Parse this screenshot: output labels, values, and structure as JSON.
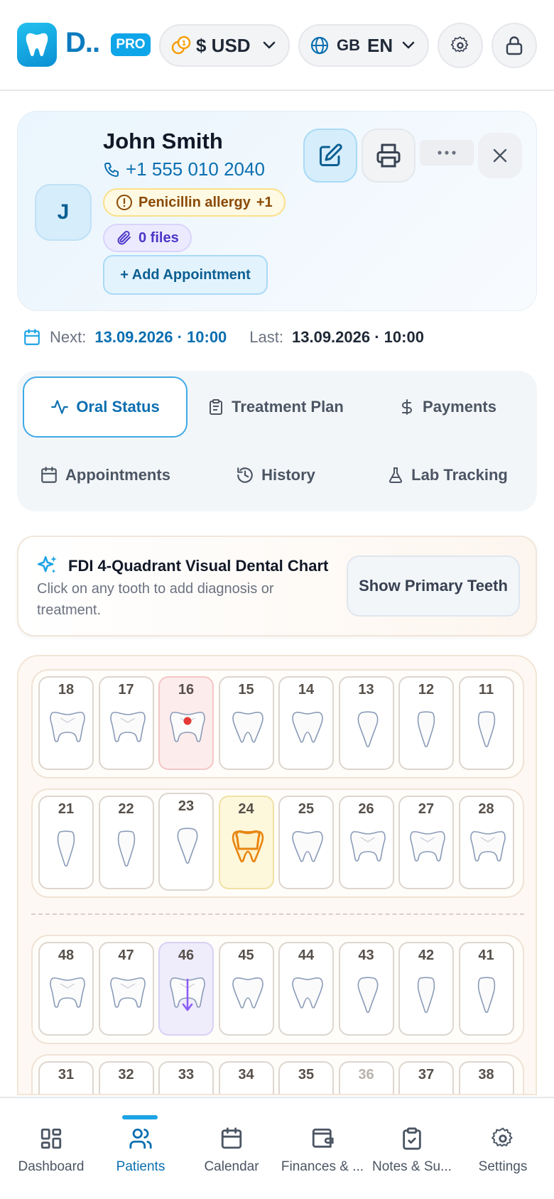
{
  "header": {
    "app_name": "D..",
    "badge": "PRO",
    "currency": "$ USD",
    "lang_code": "GB",
    "lang": "EN"
  },
  "patient": {
    "initial": "J",
    "name": "John Smith",
    "phone": "+1 555 010 2040",
    "allergy": "Penicillin allergy",
    "allergy_extra": "+1",
    "files": "0 files",
    "add_appointment": "+ Add Appointment"
  },
  "dates": {
    "next_label": "Next:",
    "next_value": "13.09.2026 · 10:00",
    "last_label": "Last:",
    "last_value": "13.09.2026 · 10:00"
  },
  "tabs": [
    {
      "label": "Oral Status",
      "icon": "activity-icon",
      "active": true
    },
    {
      "label": "Treatment Plan",
      "icon": "clipboard-icon",
      "active": false
    },
    {
      "label": "Payments",
      "icon": "dollar-icon",
      "active": false
    },
    {
      "label": "Appointments",
      "icon": "calendar-icon",
      "active": false
    },
    {
      "label": "History",
      "icon": "history-icon",
      "active": false
    },
    {
      "label": "Lab Tracking",
      "icon": "flask-icon",
      "active": false
    }
  ],
  "chart_header": {
    "title": "FDI 4-Quadrant Visual Dental Chart",
    "subtitle": "Click on any tooth to add diagnosis or treatment.",
    "toggle": "Show Primary Teeth"
  },
  "teeth": {
    "upper_right": [
      "18",
      "17",
      "16",
      "15",
      "14",
      "13",
      "12",
      "11"
    ],
    "upper_left": [
      "21",
      "22",
      "23",
      "24",
      "25",
      "26",
      "27",
      "28"
    ],
    "lower_right": [
      "48",
      "47",
      "46",
      "45",
      "44",
      "43",
      "42",
      "41"
    ],
    "lower_left": [
      "31",
      "32",
      "33",
      "34",
      "35",
      "36",
      "37",
      "38"
    ],
    "status": {
      "16": "caries",
      "24": "crown",
      "46": "extraction",
      "36": "missing"
    }
  },
  "bottom_nav": [
    {
      "label": "Dashboard",
      "icon": "grid-icon",
      "active": false
    },
    {
      "label": "Patients",
      "icon": "users-icon",
      "active": true
    },
    {
      "label": "Calendar",
      "icon": "calendar-icon",
      "active": false
    },
    {
      "label": "Finances & ...",
      "icon": "wallet-icon",
      "active": false
    },
    {
      "label": "Notes & Su...",
      "icon": "clipboard-check-icon",
      "active": false
    },
    {
      "label": "Settings",
      "icon": "gear-icon",
      "active": false
    }
  ],
  "colors": {
    "primary": "#0b6fb0",
    "accent": "#1ba3e4",
    "caries": "#e53935",
    "crown": "#e8850f",
    "extraction": "#8b5cf6"
  }
}
